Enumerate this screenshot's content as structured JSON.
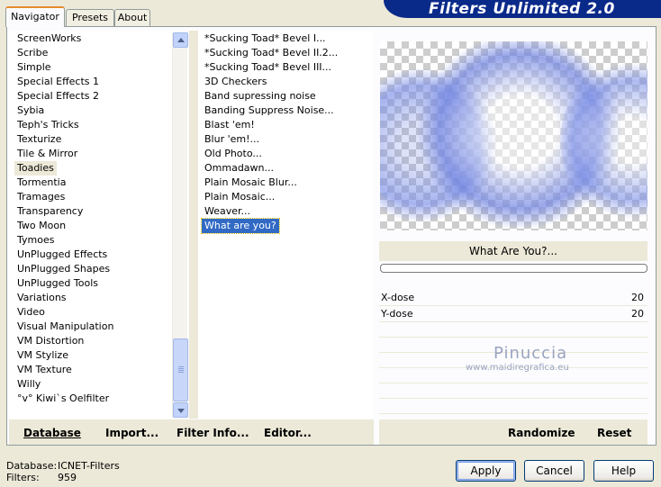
{
  "tabs": [
    {
      "label": "Navigator",
      "active": true
    },
    {
      "label": "Presets",
      "active": false
    },
    {
      "label": "About",
      "active": false
    }
  ],
  "banner": {
    "title": "Filters Unlimited 2.0",
    "color": "#0a2a8a"
  },
  "categories": [
    "ScreenWorks",
    "Scribe",
    "Simple",
    "Special Effects 1",
    "Special Effects 2",
    "Sybia",
    "Teph's Tricks",
    "Texturize",
    "Tile & Mirror",
    "Toadies",
    "Tormentia",
    "Tramages",
    "Transparency",
    "Two Moon",
    "Tymoes",
    "UnPlugged Effects",
    "UnPlugged Shapes",
    "UnPlugged Tools",
    "Variations",
    "Video",
    "Visual Manipulation",
    "VM Distortion",
    "VM Stylize",
    "VM Texture",
    "Willy",
    "°v° Kiwi`s Oelfilter"
  ],
  "highlighted_category": "Toadies",
  "filters": [
    "*Sucking Toad*  Bevel I...",
    "*Sucking Toad*  Bevel II.2...",
    "*Sucking Toad*  Bevel III...",
    "3D Checkers",
    "Band supressing noise",
    "Banding Suppress Noise...",
    "Blast 'em!",
    "Blur 'em!...",
    "Old Photo...",
    "Ommadawn...",
    "Plain Mosaic Blur...",
    "Plain Mosaic...",
    "Weaver...",
    "What are you?"
  ],
  "selected_filter": "What are you?",
  "filter_title": "What Are You?...",
  "params": [
    {
      "name": "X-dose",
      "value": "20"
    },
    {
      "name": "Y-dose",
      "value": "20"
    }
  ],
  "watermark": {
    "name": "Pinuccia",
    "url": "www.maidiregrafica.eu"
  },
  "left_buttons": {
    "database": "Database",
    "import": "Import...",
    "filter_info": "Filter Info...",
    "editor": "Editor..."
  },
  "right_buttons": {
    "randomize": "Randomize",
    "reset": "Reset"
  },
  "status": {
    "database_label": "Database:",
    "database_value": "ICNET-Filters",
    "filters_label": "Filters:",
    "filters_value": "959"
  },
  "dialog_buttons": {
    "apply": "Apply",
    "cancel": "Cancel",
    "help": "Help"
  },
  "colors": {
    "selection": "#316ac5",
    "panel_bg": "#ece9d8"
  }
}
